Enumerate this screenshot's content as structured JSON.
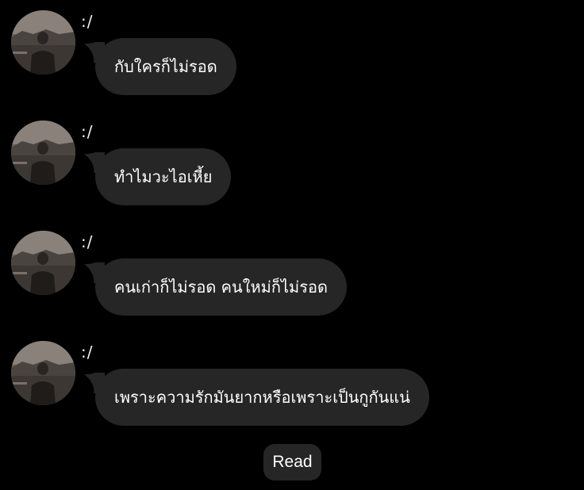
{
  "messages": [
    {
      "sender": ":/",
      "text": "กับใครก็ไม่รอด"
    },
    {
      "sender": ":/",
      "text": "ทำไมวะไอเหี้ย"
    },
    {
      "sender": ":/",
      "text": "คนเก่าก็ไม่รอด คนใหม่ก็ไม่รอด"
    },
    {
      "sender": ":/",
      "text": "เพราะความรักมันยากหรือเพราะเป็นกูกันแน่"
    }
  ],
  "status": {
    "read_label": "Read"
  },
  "colors": {
    "background": "#000000",
    "bubble": "#262626",
    "text": "#ffffff"
  }
}
